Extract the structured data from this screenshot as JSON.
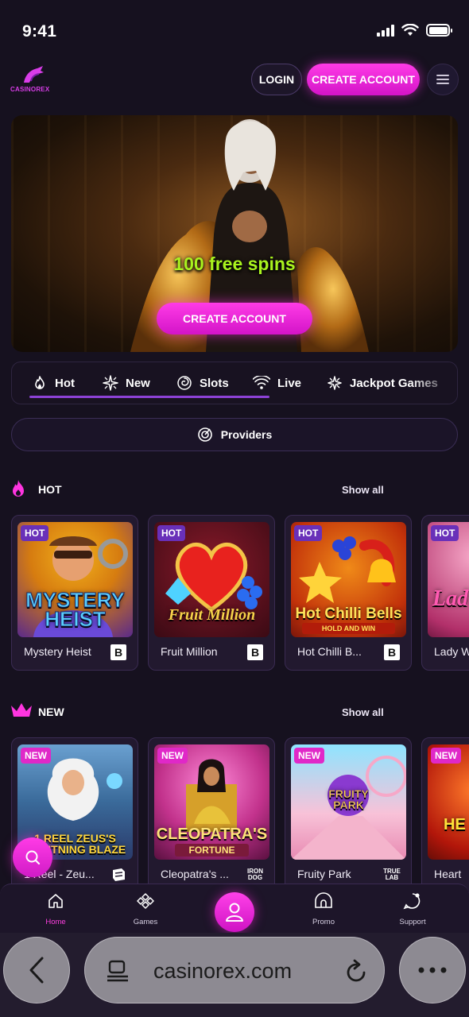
{
  "status_bar": {
    "time": "9:41"
  },
  "header": {
    "logo_text": "CASINOREX",
    "login_label": "LOGIN",
    "create_account_label": "CREATE ACCOUNT",
    "menu_icon": "hamburger-icon"
  },
  "hero": {
    "title": "100 free spins",
    "button_label": "CREATE ACCOUNT"
  },
  "tabs": [
    {
      "label": "Hot",
      "icon": "flame-icon"
    },
    {
      "label": "New",
      "icon": "sparkle-icon"
    },
    {
      "label": "Slots",
      "icon": "spiral-icon"
    },
    {
      "label": "Live",
      "icon": "wifi-icon"
    },
    {
      "label": "Jackpot Games",
      "icon": "star-burst-icon"
    }
  ],
  "providers": {
    "label": "Providers",
    "icon": "target-icon"
  },
  "sections": {
    "hot": {
      "title": "HOT",
      "show_all": "Show all",
      "badge": "HOT",
      "games": [
        {
          "name": "Mystery Heist",
          "art": "MYSTERY HEIST",
          "provider": "B"
        },
        {
          "name": "Fruit Million",
          "art": "Fruit Million",
          "provider": "B"
        },
        {
          "name": "Hot Chilli B...",
          "art": "Hot Chilli Bells",
          "art_sub": "HOLD AND WIN",
          "provider": "B"
        },
        {
          "name": "Lady W",
          "art": "Lad"
        }
      ]
    },
    "new": {
      "title": "NEW",
      "show_all": "Show all",
      "badge": "NEW",
      "games": [
        {
          "name": "1 Reel - Zeu...",
          "art": "1 REEL ZEUS'S LIGHTNING BLAZE"
        },
        {
          "name": "Cleopatra's ...",
          "art": "CLEOPATRA'S",
          "art_sub": "FORTUNE",
          "provider": "IRON DOG"
        },
        {
          "name": "Fruity Park",
          "art": "FRUITY PARK",
          "provider": "TRUE LAB"
        },
        {
          "name": "Heart",
          "art": "HE"
        }
      ]
    }
  },
  "bottom_nav": [
    {
      "label": "Home",
      "icon": "home-icon",
      "active": true
    },
    {
      "label": "Games",
      "icon": "gamepad-icon",
      "active": false
    },
    {
      "label": "",
      "icon": "user-icon",
      "active": false
    },
    {
      "label": "Promo",
      "icon": "promo-icon",
      "active": false
    },
    {
      "label": "Support",
      "icon": "chat-icon",
      "active": false
    }
  ],
  "browser": {
    "url": "casinorex.com"
  },
  "colors": {
    "accent": "#ff2fe0",
    "background": "#16111f",
    "hero_text": "#a9f31e",
    "tab_underline": "#8d42d6"
  }
}
